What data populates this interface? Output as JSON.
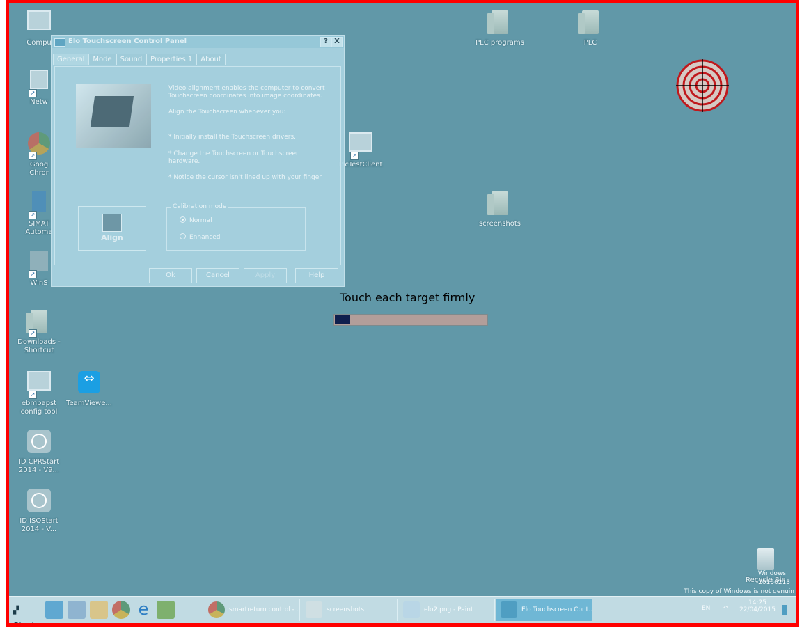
{
  "desktop": {
    "icons": [
      {
        "label": "Compu"
      },
      {
        "label": "Netw"
      },
      {
        "label": "Goog\nChror"
      },
      {
        "label": "SIMAT\nAutoma"
      },
      {
        "label": "WinS"
      },
      {
        "label": "Downloads -\nShortcut"
      },
      {
        "label": "ebmpapst\nconfig tool"
      },
      {
        "label": "TeamViewe..."
      },
      {
        "label": "ID CPRStart\n2014 - V9..."
      },
      {
        "label": "ID ISOStart\n2014 - V..."
      },
      {
        "label": "PLC programs"
      },
      {
        "label": "PLC"
      },
      {
        "label": "PlcTestClient"
      },
      {
        "label": "screenshots"
      },
      {
        "label": "Recycle Bin"
      }
    ]
  },
  "dialog": {
    "title": "Elo Touchscreen Control Panel",
    "help_btn": "?",
    "close_btn": "X",
    "tabs": [
      "General",
      "Mode",
      "Sound",
      "Properties 1",
      "About"
    ],
    "active_tab": "General",
    "intro": "Video alignment enables the computer to convert Touchscreen coordinates into image coordinates.",
    "align_when": "Align the Touchscreen whenever you:",
    "bullet_1": "* Initially install the Touchscreen drivers.",
    "bullet_2": "* Change the Touchscreen or Touchscreen hardware.",
    "bullet_3": "* Notice the cursor isn't lined up with your finger.",
    "align_label": "Align",
    "calibration": {
      "legend": "Calibration mode",
      "options": [
        "Normal",
        "Enhanced"
      ],
      "selected": "Normal"
    },
    "buttons": {
      "ok": "Ok",
      "cancel": "Cancel",
      "apply": "Apply",
      "help": "Help"
    }
  },
  "calibration_overlay": {
    "prompt": "Touch each target firmly",
    "progress_fraction": 0.1,
    "target_color": "#c0181c"
  },
  "watermark": {
    "line1": "Windows",
    "line2": "-20150213",
    "line3": "This copy of Windows is not genuin"
  },
  "taskbar": {
    "start_label": "Start",
    "items": [
      {
        "label": "smartreturn control - ..."
      },
      {
        "label": "screenshots"
      },
      {
        "label": "elo2.png - Paint"
      },
      {
        "label": "Elo Touchscreen Cont..."
      }
    ],
    "active_item": 3,
    "lang": "EN",
    "tray_chevron": "^",
    "time": "14:25",
    "date": "22/04/2015"
  }
}
